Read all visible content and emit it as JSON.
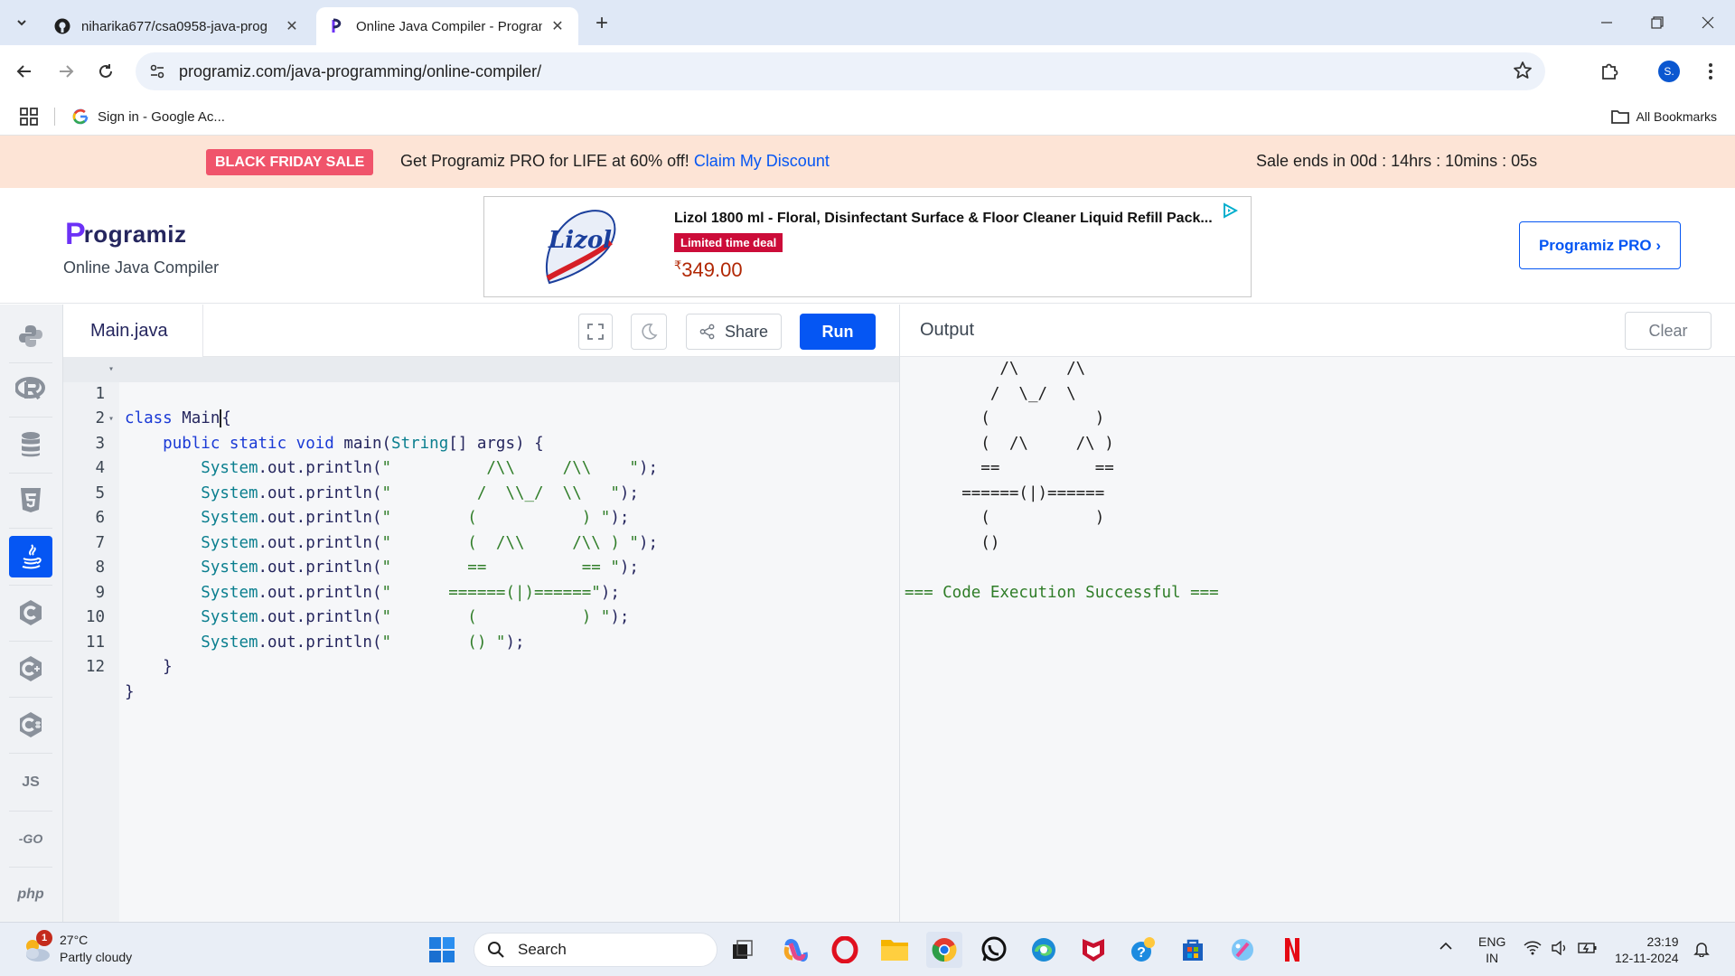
{
  "browser": {
    "tabs": [
      {
        "title": "niharika677/csa0958-java-prog",
        "favicon": "github-icon",
        "active": false
      },
      {
        "title": "Online Java Compiler - Program",
        "favicon": "programiz-icon",
        "active": true
      }
    ],
    "url": "programiz.com/java-programming/online-compiler/",
    "profile_initial": "S.",
    "bookmarks": [
      {
        "label": "Sign in - Google Ac..."
      }
    ],
    "all_bookmarks_label": "All Bookmarks"
  },
  "sale_banner": {
    "badge": "BLACK FRIDAY SALE",
    "text": "Get Programiz PRO for LIFE at 60% off!",
    "link": "Claim My Discount",
    "timer": "Sale ends in 00d : 14hrs : 10mins : 05s"
  },
  "header": {
    "logo_text": "rogramiz",
    "logo_letter": "P",
    "subtitle": "Online Java Compiler",
    "pro_button": "Programiz PRO ›"
  },
  "ad": {
    "title": "Lizol 1800 ml - Floral, Disinfectant Surface & Floor Cleaner Liquid Refill Pack...",
    "deal": "Limited time deal",
    "currency": "₹",
    "price": "349.00",
    "brand": "Lizol"
  },
  "sidebar": {
    "languages": [
      {
        "name": "python",
        "icon": "python-icon"
      },
      {
        "name": "r",
        "icon": "r-icon"
      },
      {
        "name": "sql",
        "icon": "database-icon"
      },
      {
        "name": "html",
        "icon": "html5-icon"
      },
      {
        "name": "java",
        "icon": "java-icon",
        "active": true
      },
      {
        "name": "c",
        "icon": "c-icon"
      },
      {
        "name": "cpp",
        "icon": "cpp-icon"
      },
      {
        "name": "csharp",
        "icon": "csharp-icon"
      },
      {
        "name": "javascript",
        "label": "JS"
      },
      {
        "name": "go",
        "label": "-GO"
      },
      {
        "name": "php",
        "label": "php"
      }
    ]
  },
  "editor": {
    "filename": "Main.java",
    "share_label": "Share",
    "run_label": "Run",
    "lines": [
      {
        "num": "1",
        "text": "class Main{"
      },
      {
        "num": "2",
        "text": "    public static void main(String[] args) {"
      },
      {
        "num": "3",
        "text": "        System.out.println(\"          /\\\\     /\\\\    \");"
      },
      {
        "num": "4",
        "text": "        System.out.println(\"         /  \\\\_/  \\\\   \");"
      },
      {
        "num": "5",
        "text": "        System.out.println(\"        (           ) \");"
      },
      {
        "num": "6",
        "text": "        System.out.println(\"        (  /\\\\     /\\\\ ) \");"
      },
      {
        "num": "7",
        "text": "        System.out.println(\"        ==          == \");"
      },
      {
        "num": "8",
        "text": "        System.out.println(\"      ======(|)======\");"
      },
      {
        "num": "9",
        "text": "        System.out.println(\"        (           ) \");"
      },
      {
        "num": "10",
        "text": "        System.out.println(\"        () \");"
      },
      {
        "num": "11",
        "text": "    }"
      },
      {
        "num": "12",
        "text": "}"
      }
    ]
  },
  "output": {
    "title": "Output",
    "clear_label": "Clear",
    "lines": [
      "          /\\     /\\",
      "         /  \\_/  \\",
      "        (           )",
      "        (  /\\     /\\ )",
      "        ==          ==",
      "      ======(|)======",
      "        (           )",
      "        ()",
      "",
      "=== Code Execution Successful ==="
    ]
  },
  "taskbar": {
    "temperature": "27°C",
    "weather": "Partly cloudy",
    "weather_badge": "1",
    "search_label": "Search",
    "language": "ENG",
    "region": "IN",
    "time": "23:19",
    "date": "12-11-2024"
  }
}
